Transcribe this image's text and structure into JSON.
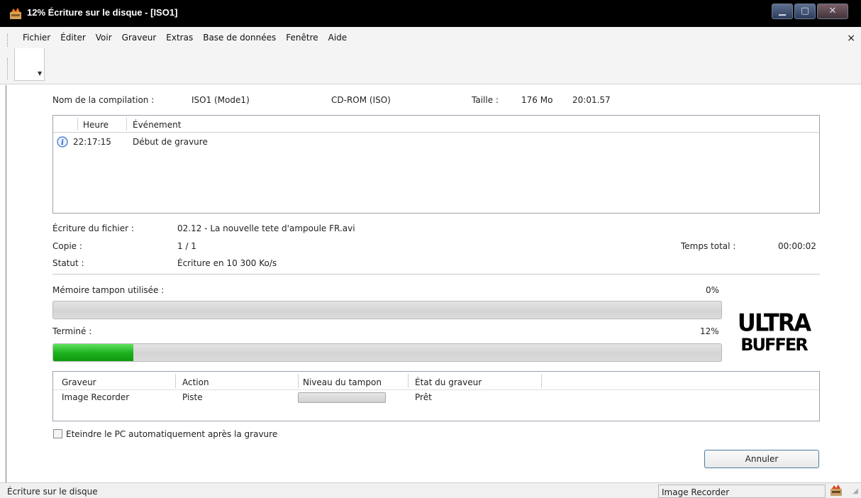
{
  "window": {
    "title": "12% Écriture sur le disque - [ISO1]",
    "close_glyph": "×"
  },
  "menu": [
    "Fichier",
    "Éditer",
    "Voir",
    "Graveur",
    "Extras",
    "Base de données",
    "Fenêtre",
    "Aide"
  ],
  "compilation": {
    "label": "Nom de la compilation :",
    "name": "ISO1 (Mode1)",
    "type": "CD-ROM (ISO)",
    "size_label": "Taille :",
    "size": "176 Mo",
    "duration": "20:01.57"
  },
  "events": {
    "col_time": "Heure",
    "col_event": "Événement",
    "rows": [
      {
        "icon": "info-icon",
        "time": "22:17:15",
        "event": "Début de gravure"
      }
    ]
  },
  "progress_info": {
    "file_label": "Écriture du fichier :",
    "file": "02.12 - La nouvelle tete d'ampoule FR.avi",
    "copy_label": "Copie :",
    "copy": "1 / 1",
    "status_label": "Statut :",
    "status": "Écriture en 10 300 Ko/s",
    "total_time_label": "Temps total :",
    "total_time": "00:00:02"
  },
  "buffer": {
    "label": "Mémoire tampon utilisée :",
    "percent_text": "0%",
    "fraction": 0.0
  },
  "done": {
    "label": "Terminé :",
    "percent_text": "12%",
    "fraction": 0.12
  },
  "logo": {
    "line1": "ULTRA",
    "line2": "BUFFER"
  },
  "drives": {
    "columns": [
      "Graveur",
      "Action",
      "Niveau du tampon",
      "État du graveur"
    ],
    "rows": [
      {
        "drive": "Image Recorder",
        "action": "Piste",
        "buffer_fraction": 0.0,
        "state": "Prêt"
      }
    ]
  },
  "shutdown_checkbox": {
    "label": "Eteindre le PC automatiquement après la gravure",
    "checked": false
  },
  "cancel_button": "Annuler",
  "statusbar": {
    "left": "Écriture sur le disque",
    "right": "Image Recorder"
  },
  "colors": {
    "progress_green": "#1fb21f",
    "titlebar": "#000000"
  }
}
